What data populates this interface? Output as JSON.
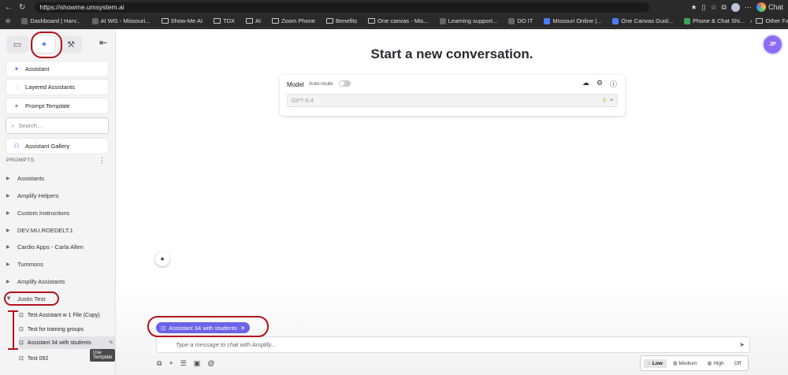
{
  "browser": {
    "url": "https://showme.umsystem.ai",
    "chat_label": "Chat",
    "bookmarks": [
      {
        "label": "Dashboard | Harv...",
        "kind": "site"
      },
      {
        "label": "AI WG - Missouri...",
        "kind": "site"
      },
      {
        "label": "Show-Me AI",
        "kind": "folder"
      },
      {
        "label": "TDX",
        "kind": "folder"
      },
      {
        "label": "AI",
        "kind": "folder"
      },
      {
        "label": "Zoom Phone",
        "kind": "folder"
      },
      {
        "label": "Benefits",
        "kind": "folder"
      },
      {
        "label": "One canvas - Mis...",
        "kind": "folder"
      },
      {
        "label": "Learning support...",
        "kind": "site"
      },
      {
        "label": "DO IT",
        "kind": "site"
      },
      {
        "label": "Missouri Online |...",
        "kind": "site"
      },
      {
        "label": "One Canvas Guid...",
        "kind": "site"
      },
      {
        "label": "Phone & Chat Shi...",
        "kind": "site"
      }
    ],
    "other_favorites": "Other Favorites"
  },
  "sidebar": {
    "items": [
      {
        "label": "Assistant"
      },
      {
        "label": "Layered Assistants"
      },
      {
        "label": "Prompt Template"
      }
    ],
    "search_placeholder": "Search...",
    "gallery_label": "Assistant Gallery",
    "prompts_header": "PROMPTS",
    "folders": [
      "Assistants",
      "Amplify Helpers",
      "Custom Instructions",
      "DEV.MU.ROEDELT.1",
      "Cardio Apps - Carla Allen",
      "Tummons",
      "Amplify Assistants",
      "Justin Test"
    ],
    "templates": [
      "Test Assistant w 1 File (Copy)",
      "Test for training groups",
      "Assistant 34 with students",
      "Test 092"
    ],
    "tooltip": "Use Template"
  },
  "main": {
    "title": "Start a new conversation.",
    "user_initials": "JP",
    "model_label": "Model",
    "autoroute_label": "Auto-route",
    "model_value": "GPT-5.4",
    "assistant_chip": "Assistant 34 with students",
    "chat_placeholder": "Type a message to chat with Amplify...",
    "effort_options": [
      "Low",
      "Medium",
      "High",
      "Off"
    ],
    "effort_selected": "Low"
  },
  "colors": {
    "accent": "#6b63e8",
    "annotation": "#b3111d",
    "avatar": "#8b6cf2"
  }
}
